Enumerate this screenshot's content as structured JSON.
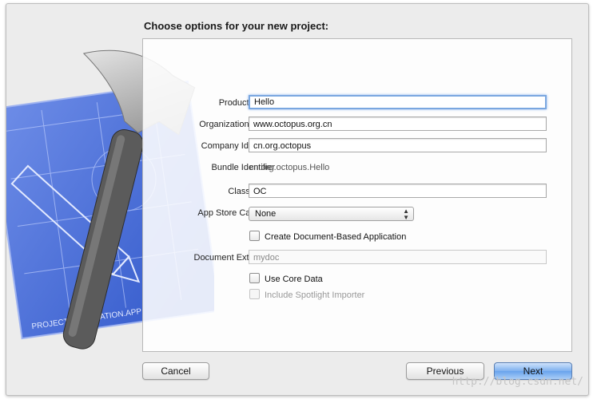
{
  "dialog": {
    "title": "Choose options for your new project:"
  },
  "form": {
    "product_name": {
      "label": "Product Name",
      "value": "Hello"
    },
    "organization_name": {
      "label": "Organization Name",
      "value": "www.octopus.org.cn"
    },
    "company_identifier": {
      "label": "Company Identifier",
      "value": "cn.org.octopus"
    },
    "bundle_identifier": {
      "label": "Bundle Identifier",
      "value": "cn.org.octopus.Hello"
    },
    "class_prefix": {
      "label": "Class Prefix",
      "value": "OC"
    },
    "app_store_category": {
      "label": "App Store Category",
      "value": "None"
    },
    "document_based": {
      "label": "Create Document-Based Application",
      "checked": false
    },
    "document_extension": {
      "label": "Document Extension",
      "value": "mydoc"
    },
    "core_data": {
      "label": "Use Core Data",
      "checked": false
    },
    "spotlight_importer": {
      "label": "Include Spotlight Importer",
      "checked": false,
      "enabled": false
    }
  },
  "buttons": {
    "cancel": "Cancel",
    "previous": "Previous",
    "next": "Next"
  },
  "blueprint": {
    "label": "PROJECT: APPLICATION.APP"
  },
  "watermark": "http://blog.csdn.net/"
}
